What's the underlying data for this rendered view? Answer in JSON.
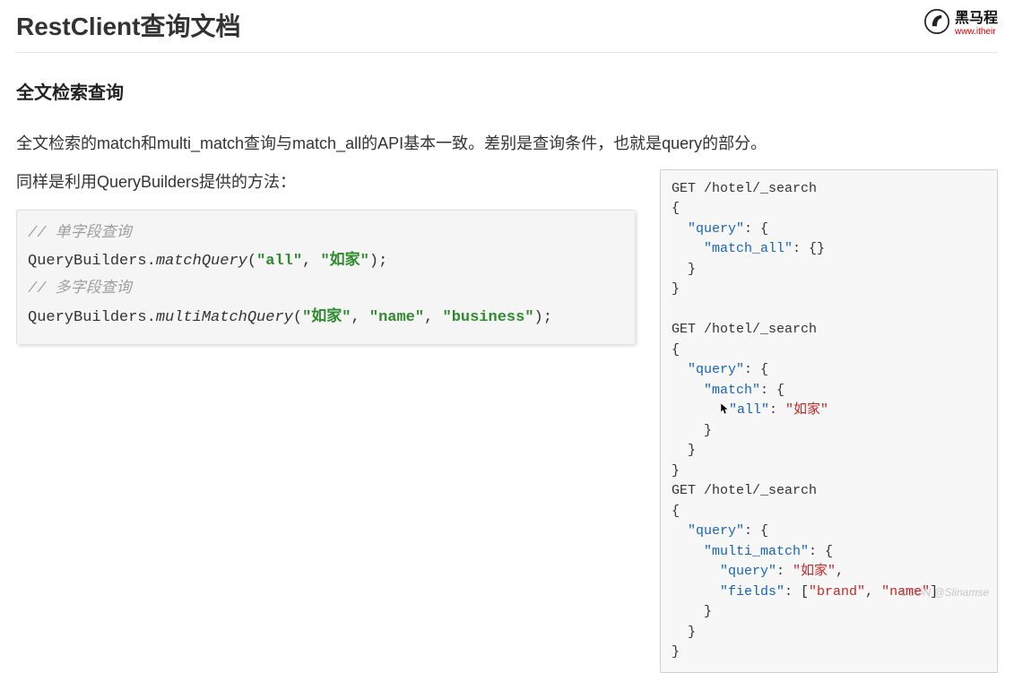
{
  "header": {
    "title": "RestClient查询文档",
    "brand_name": "黑马程",
    "brand_sub": "www.itheir"
  },
  "section": {
    "heading": "全文检索查询",
    "para1": "全文检索的match和multi_match查询与match_all的API基本一致。差别是查询条件，也就是query的部分。",
    "para2": "同样是利用QueryBuilders提供的方法："
  },
  "left_code": {
    "c1": "// 单字段查询",
    "l2a": "QueryBuilders.",
    "l2b": "matchQuery",
    "l2c": "(",
    "l2d": "\"all\"",
    "l2e": ", ",
    "l2f": "\"如家\"",
    "l2g": ");",
    "c3": "// 多字段查询",
    "l4a": "QueryBuilders.",
    "l4b": "multiMatchQuery",
    "l4c": "(",
    "l4d": "\"如家\"",
    "l4e": ", ",
    "l4f": "\"name\"",
    "l4g": ", ",
    "l4h": "\"business\"",
    "l4i": ");"
  },
  "right_code": {
    "r01": "GET /hotel/_search",
    "r02": "{",
    "r03a": "  ",
    "r03b": "\"query\"",
    "r03c": ": {",
    "r04a": "    ",
    "r04b": "\"match_all\"",
    "r04c": ": {}",
    "r05": "  }",
    "r06": "}",
    "r07": "",
    "r08": "GET /hotel/_search",
    "r09": "{",
    "r10a": "  ",
    "r10b": "\"query\"",
    "r10c": ": {",
    "r11a": "    ",
    "r11b": "\"match\"",
    "r11c": ": {",
    "r12a": "      ",
    "r12b": "\"all\"",
    "r12c": ": ",
    "r12d": "\"如家\"",
    "r13": "    }",
    "r14": "  }",
    "r15": "}",
    "r16": "GET /hotel/_search",
    "r17": "{",
    "r18a": "  ",
    "r18b": "\"query\"",
    "r18c": ": {",
    "r19a": "    ",
    "r19b": "\"multi_match\"",
    "r19c": ": {",
    "r20a": "      ",
    "r20b": "\"query\"",
    "r20c": ": ",
    "r20d": "\"如家\"",
    "r20e": ",",
    "r21a": "      ",
    "r21b": "\"fields\"",
    "r21c": ": [",
    "r21d": "\"brand\"",
    "r21e": ", ",
    "r21f": "\"name\"",
    "r21g": "]",
    "r22": "    }",
    "r23": "  }",
    "r24": "}"
  },
  "watermark": "CSDN @Slinamse"
}
